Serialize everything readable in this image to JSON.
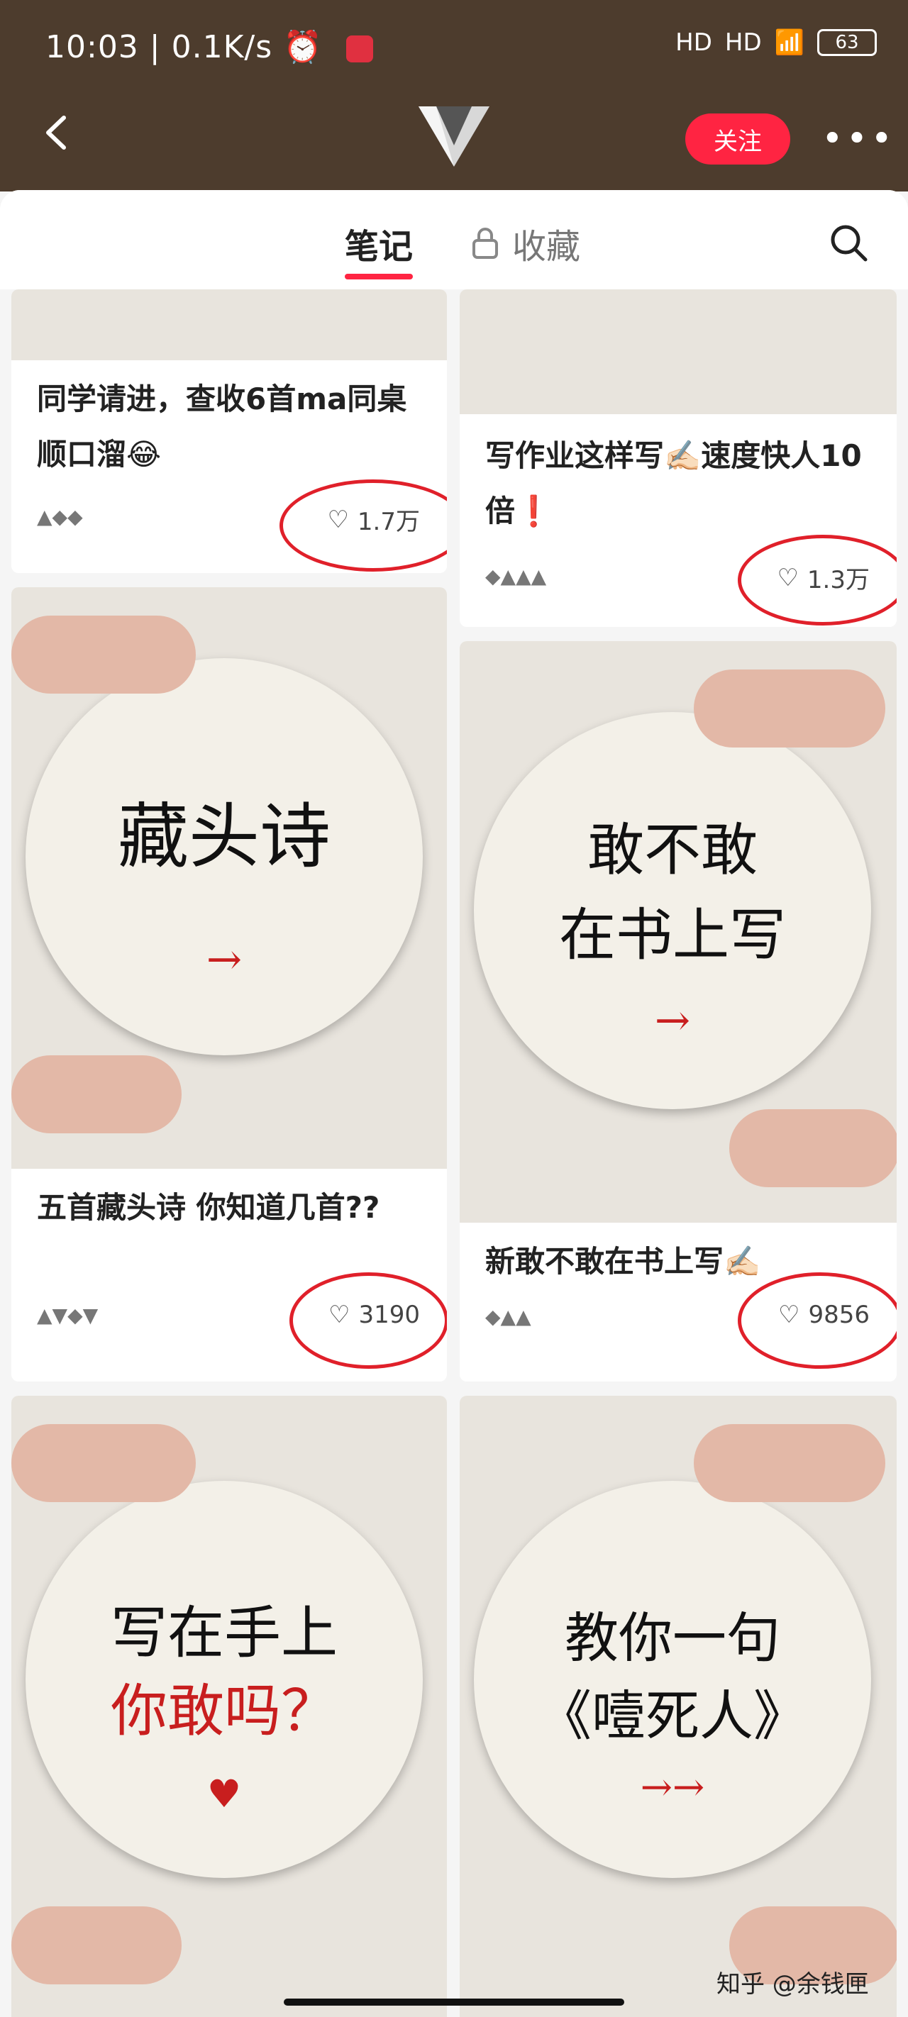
{
  "status": {
    "time": "10:03 | 0.1K/s",
    "battery": "63",
    "signal1": "HD",
    "signal2": "HD"
  },
  "header": {
    "follow_label": "关注"
  },
  "tabs": {
    "notes": "笔记",
    "favorites": "收藏"
  },
  "cards": [
    {
      "title": "同学请进，查收6首ma同桌顺口溜😂",
      "likes": "1.7万"
    },
    {
      "title": "写作业这样写✍🏻速度快人10倍❗",
      "likes": "1.3万"
    },
    {
      "title": "五首藏头诗 你知道几首??",
      "likes": "3190"
    },
    {
      "title": "新敢不敢在书上写✍🏻",
      "likes": "9856"
    }
  ],
  "disks": [
    {
      "line1": "藏头诗",
      "line2": "",
      "arrow": "→"
    },
    {
      "line1": "敢不敢",
      "line2": "在书上写",
      "arrow": "→"
    },
    {
      "line1": "写在手上",
      "line2": "你敢吗？",
      "arrow": "♥"
    },
    {
      "line1": "教你一句",
      "line2": "《噎死人》",
      "arrow": "→→"
    }
  ],
  "watermark": "知乎 @余钱匣"
}
